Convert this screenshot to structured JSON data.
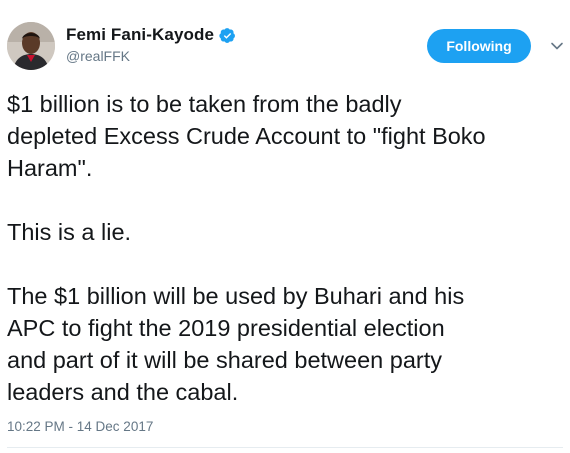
{
  "author": {
    "display_name": "Femi Fani-Kayode",
    "handle": "@realFFK",
    "verified": true
  },
  "follow_button": {
    "label": "Following"
  },
  "icons": {
    "verified": "verified-badge-icon",
    "caret": "chevron-down-icon"
  },
  "colors": {
    "accent": "#1da1f2",
    "text": "#14171a",
    "muted": "#657786"
  },
  "tweet": {
    "paragraphs": [
      "$1 billion is to be taken from the badly\ndepleted Excess Crude Account to \"fight Boko\nHaram\".",
      "This is a lie.",
      "The $1 billion will be used by Buhari and his\nAPC to fight the 2019 presidential election\nand part of it will be shared between party\nleaders and the cabal."
    ],
    "timestamp": "10:22 PM - 14 Dec 2017"
  }
}
